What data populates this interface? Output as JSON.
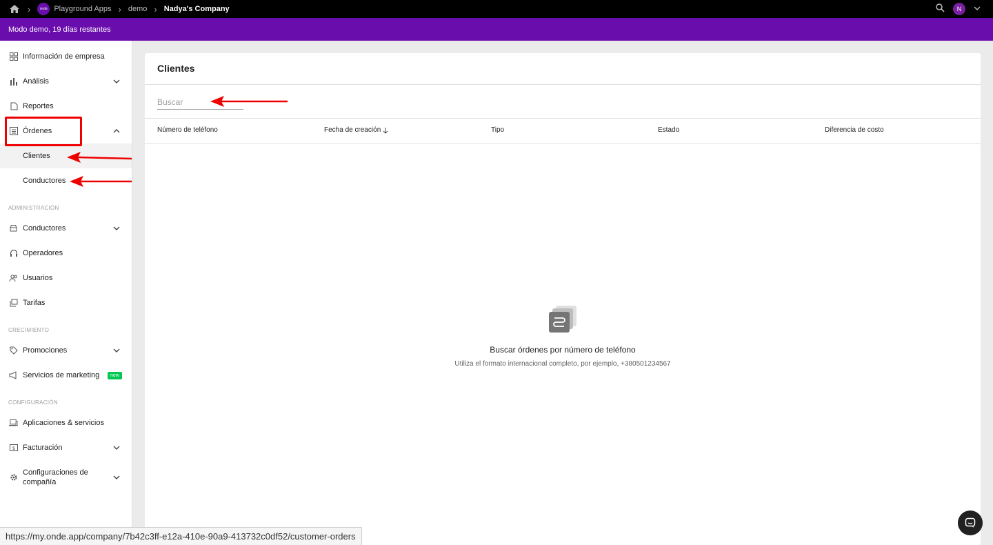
{
  "topbar": {
    "breadcrumbs": [
      "Playground Apps",
      "demo",
      "Nadya's Company"
    ],
    "app_logo_text": "onde",
    "avatar_initial": "N"
  },
  "banner": {
    "text": "Modo demo, 19 días restantes"
  },
  "sidebar": {
    "items": [
      {
        "label": "Información de empresa",
        "icon": "grid-icon"
      },
      {
        "label": "Análisis",
        "icon": "bar-chart-icon"
      },
      {
        "label": "Reportes",
        "icon": "document-icon"
      },
      {
        "label": "Órdenes",
        "icon": "list-icon"
      },
      {
        "label": "Clientes"
      },
      {
        "label": "Conductores"
      }
    ],
    "section_admin": "ADMINISTRACIÓN",
    "admin_items": [
      {
        "label": "Conductores",
        "icon": "car-icon"
      },
      {
        "label": "Operadores",
        "icon": "headset-icon"
      },
      {
        "label": "Usuarios",
        "icon": "users-icon"
      },
      {
        "label": "Tarifas",
        "icon": "tariff-icon"
      }
    ],
    "section_growth": "CRECIMIENTO",
    "growth_items": [
      {
        "label": "Promociones",
        "icon": "tag-icon"
      },
      {
        "label": "Servicios de marketing",
        "icon": "megaphone-icon",
        "badge": "new"
      }
    ],
    "section_config": "CONFIGURACIÓN",
    "config_items": [
      {
        "label": "Aplicaciones & servicios",
        "icon": "devices-icon"
      },
      {
        "label": "Facturación",
        "icon": "billing-icon"
      },
      {
        "label": "Configuraciones de compañía",
        "label_line1": "Configuraciones de",
        "label_line2": "compañía",
        "icon": "gear-icon"
      }
    ]
  },
  "main": {
    "title": "Clientes",
    "search_placeholder": "Buscar",
    "columns": [
      "Número de teléfono",
      "Fecha de creación",
      "Tipo",
      "Estado",
      "Diferencia de costo"
    ],
    "empty_title": "Buscar órdenes por número de teléfono",
    "empty_subtitle": "Utiliza el formato internacional completo, por ejemplo, +380501234567"
  },
  "statusbar": {
    "url": "https://my.onde.app/company/7b42c3ff-e12a-410e-90a9-413732c0df52/customer-orders"
  },
  "colors": {
    "brand": "#6a0dad",
    "annotation": "#e00000",
    "new_badge": "#00c853"
  }
}
